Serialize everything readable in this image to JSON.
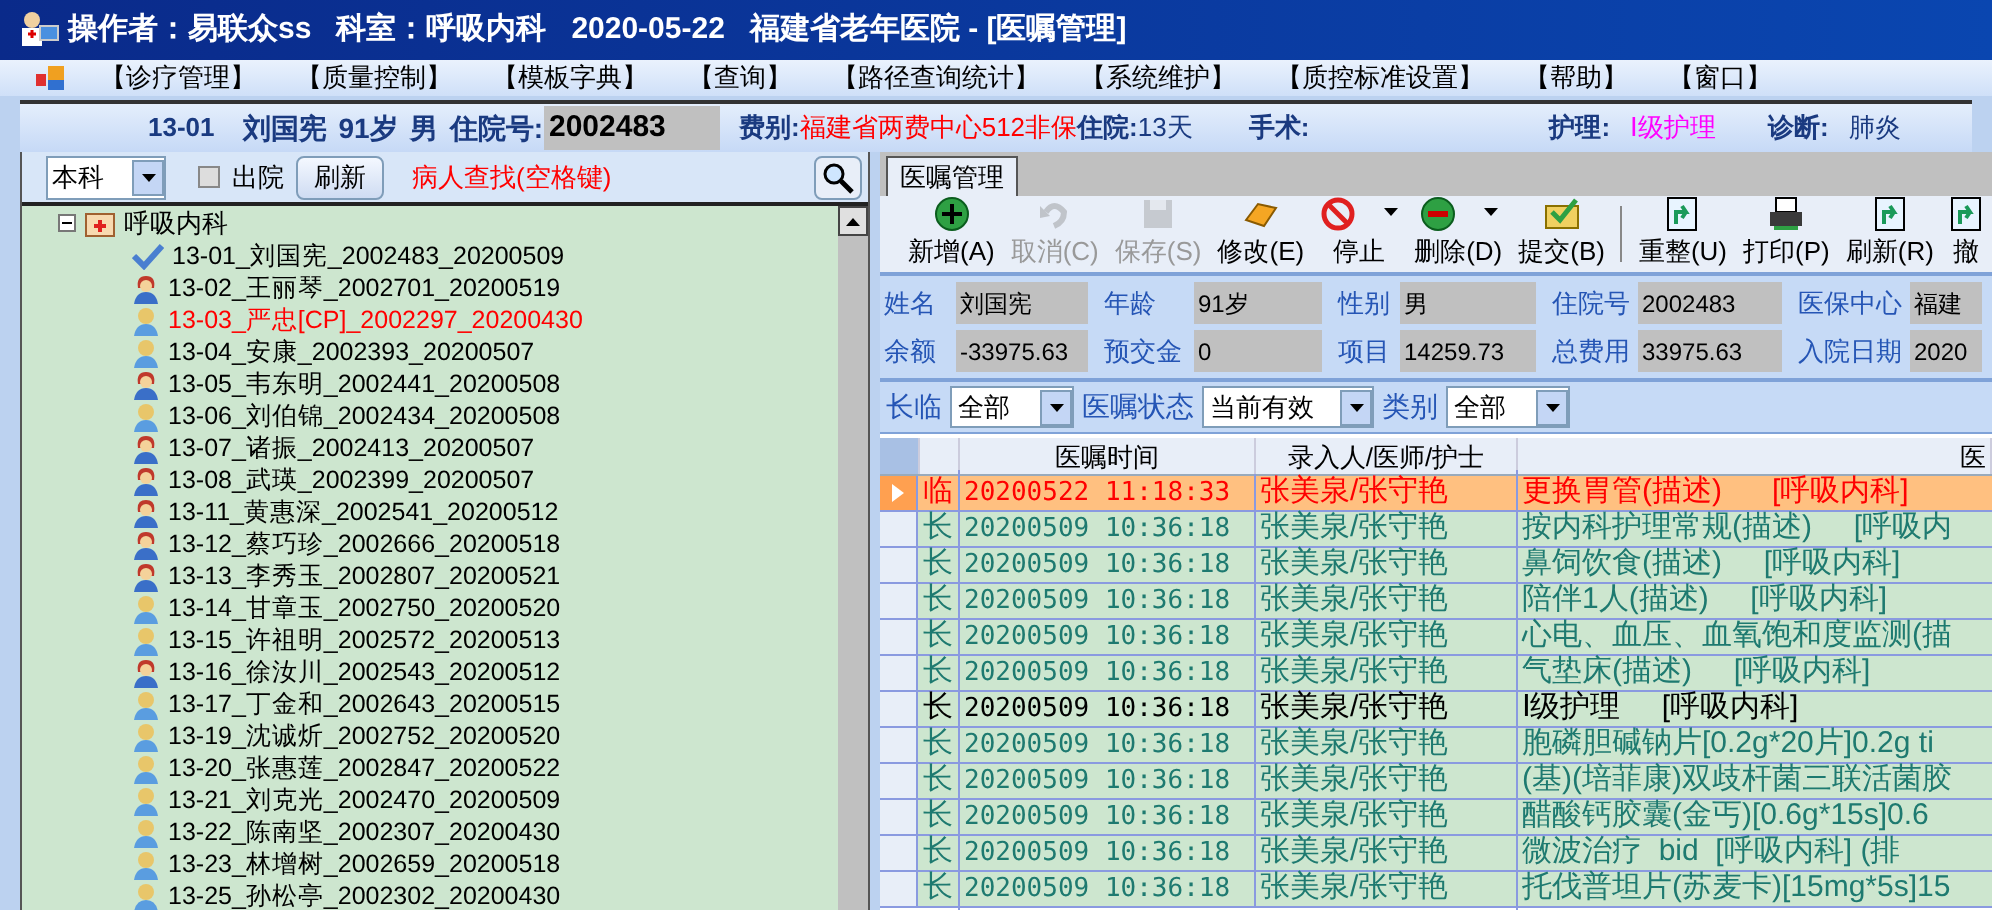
{
  "window": {
    "title": "操作者：易联众ss   科室：呼吸内科   2020-05-22   福建省老年医院 - [医嘱管理]"
  },
  "menu": [
    "【诊疗管理】",
    "【质量控制】",
    "【模板字典】",
    "【查询】",
    "【路径查询统计】",
    "【系统维护】",
    "【质控标准设置】",
    "【帮助】",
    "【窗口】"
  ],
  "patient_header": {
    "bed": "13-01",
    "name": "刘国宪",
    "age": "91岁",
    "sex": "男",
    "admission_label": "住院号:",
    "admission_no": "2002483",
    "fee_label": "费别:",
    "fee_type": "福建省两费中心512非保",
    "stay_label": "住院:",
    "stay": "13天",
    "surgery_label": "手术:",
    "nursing_label": "护理:",
    "nursing": "Ⅰ级护理",
    "diagnosis_label": "诊断:",
    "diagnosis": "肺炎"
  },
  "patient_list": {
    "department_select": "本科",
    "discharged": {
      "label": "出院",
      "checked": false
    },
    "refresh_button": "刷新",
    "search_hint": "病人查找(空格键)",
    "tree": [
      {
        "label": "呼吸内科",
        "expanded": true,
        "children": [
          {
            "label": "13-01_刘国宪_2002483_20200509",
            "kind": "checked",
            "alert": false
          },
          {
            "label": "13-02_王丽琴_2002701_20200519",
            "kind": "female",
            "alert": false
          },
          {
            "label": "13-03_严忠[CP]_2002297_20200430",
            "kind": "male",
            "alert": true
          },
          {
            "label": "13-04_安康_2002393_20200507",
            "kind": "male",
            "alert": false
          },
          {
            "label": "13-05_韦东明_2002441_20200508",
            "kind": "female",
            "alert": false
          },
          {
            "label": "13-06_刘伯锦_2002434_20200508",
            "kind": "male",
            "alert": false
          },
          {
            "label": "13-07_诸振_2002413_20200507",
            "kind": "female",
            "alert": false
          },
          {
            "label": "13-08_武瑛_2002399_20200507",
            "kind": "female",
            "alert": false
          },
          {
            "label": "13-11_黄惠深_2002541_20200512",
            "kind": "female",
            "alert": false
          },
          {
            "label": "13-12_蔡巧珍_2002666_20200518",
            "kind": "female",
            "alert": false
          },
          {
            "label": "13-13_李秀玉_2002807_20200521",
            "kind": "female",
            "alert": false
          },
          {
            "label": "13-14_甘章玉_2002750_20200520",
            "kind": "male",
            "alert": false
          },
          {
            "label": "13-15_许祖明_2002572_20200513",
            "kind": "male",
            "alert": false
          },
          {
            "label": "13-16_徐汝川_2002543_20200512",
            "kind": "female",
            "alert": false
          },
          {
            "label": "13-17_丁金和_2002643_20200515",
            "kind": "male",
            "alert": false
          },
          {
            "label": "13-19_沈诚炘_2002752_20200520",
            "kind": "male",
            "alert": false
          },
          {
            "label": "13-20_张惠莲_2002847_20200522",
            "kind": "male",
            "alert": false
          },
          {
            "label": "13-21_刘克光_2002470_20200509",
            "kind": "male",
            "alert": false
          },
          {
            "label": "13-22_陈南坚_2002307_20200430",
            "kind": "male",
            "alert": false
          },
          {
            "label": "13-23_林增树_2002659_20200518",
            "kind": "male",
            "alert": false
          },
          {
            "label": "13-25_孙松亭_2002302_20200430",
            "kind": "male",
            "alert": false
          }
        ]
      }
    ]
  },
  "tabs": [
    {
      "label": "医嘱管理",
      "selected": true
    }
  ],
  "toolbar": [
    {
      "label": "新增(A)",
      "kind": "add",
      "disabled": false,
      "dropdown": false
    },
    {
      "label": "取消(C)",
      "kind": "undo",
      "disabled": true,
      "dropdown": false
    },
    {
      "label": "保存(S)",
      "kind": "save",
      "disabled": true,
      "dropdown": false
    },
    {
      "label": "修改(E)",
      "kind": "edit",
      "disabled": false,
      "dropdown": false
    },
    {
      "label": "停止",
      "kind": "stop",
      "disabled": false,
      "dropdown": true
    },
    {
      "label": "删除(D)",
      "kind": "delete",
      "disabled": false,
      "dropdown": true
    },
    {
      "label": "提交(B)",
      "kind": "submit",
      "disabled": false,
      "dropdown": false
    },
    {
      "label": "重整(U)",
      "kind": "reorganize",
      "disabled": false,
      "dropdown": false
    },
    {
      "label": "打印(P)",
      "kind": "print",
      "disabled": false,
      "dropdown": false
    },
    {
      "label": "刷新(R)",
      "kind": "reorganize",
      "disabled": false,
      "dropdown": false
    },
    {
      "label": "撤",
      "kind": "reorganize",
      "disabled": false,
      "dropdown": false
    }
  ],
  "patient_info": [
    {
      "label": "姓名",
      "value": "刘国宪"
    },
    {
      "label": "年龄",
      "value": "91岁"
    },
    {
      "label": "性别",
      "value": "男"
    },
    {
      "label": "住院号",
      "value": "2002483"
    },
    {
      "label": "医保中心",
      "value": "福建"
    },
    {
      "label": "余额",
      "value": "-33975.63"
    },
    {
      "label": "预交金",
      "value": "0"
    },
    {
      "label": "项目",
      "value": "14259.73"
    },
    {
      "label": "总费用",
      "value": "33975.63"
    },
    {
      "label": "入院日期",
      "value": "2020"
    }
  ],
  "filters": [
    {
      "label": "长临",
      "value": "全部"
    },
    {
      "label": "医嘱状态",
      "value": "当前有效"
    },
    {
      "label": "类别",
      "value": "全部"
    }
  ],
  "orders_table": {
    "columns": [
      "医嘱时间",
      "录入人/医师/护士",
      "医"
    ],
    "rows": [
      {
        "selected": true,
        "kind": "alert",
        "type": "临",
        "time": "20200522 11:18:33",
        "staff": "张美泉/张守艳",
        "content": "更换胃管(描述)      [呼吸内科]"
      },
      {
        "selected": false,
        "kind": "active",
        "type": "长",
        "time": "20200509 10:36:18",
        "staff": "张美泉/张守艳",
        "content": "按内科护理常规(描述)     [呼吸内"
      },
      {
        "selected": false,
        "kind": "active",
        "type": "长",
        "time": "20200509 10:36:18",
        "staff": "张美泉/张守艳",
        "content": "鼻饲饮食(描述)     [呼吸内科]"
      },
      {
        "selected": false,
        "kind": "active",
        "type": "长",
        "time": "20200509 10:36:18",
        "staff": "张美泉/张守艳",
        "content": "陪伴1人(描述)     [呼吸内科]"
      },
      {
        "selected": false,
        "kind": "active",
        "type": "长",
        "time": "20200509 10:36:18",
        "staff": "张美泉/张守艳",
        "content": "心电、血压、血氧饱和度监测(描"
      },
      {
        "selected": false,
        "kind": "active",
        "type": "长",
        "time": "20200509 10:36:18",
        "staff": "张美泉/张守艳",
        "content": "气垫床(描述)     [呼吸内科]"
      },
      {
        "selected": false,
        "kind": "plain",
        "type": "长",
        "time": "20200509 10:36:18",
        "staff": "张美泉/张守艳",
        "content": "Ⅰ级护理     [呼吸内科]"
      },
      {
        "selected": false,
        "kind": "active",
        "type": "长",
        "time": "20200509 10:36:18",
        "staff": "张美泉/张守艳",
        "content": "胞磷胆碱钠片[0.2g*20片]0.2g ti"
      },
      {
        "selected": false,
        "kind": "active",
        "type": "长",
        "time": "20200509 10:36:18",
        "staff": "张美泉/张守艳",
        "content": "(基)(培菲康)双歧杆菌三联活菌胶"
      },
      {
        "selected": false,
        "kind": "active",
        "type": "长",
        "time": "20200509 10:36:18",
        "staff": "张美泉/张守艳",
        "content": "醋酸钙胶囊(金丐)[0.6g*15s]0.6"
      },
      {
        "selected": false,
        "kind": "active",
        "type": "长",
        "time": "20200509 10:36:18",
        "staff": "张美泉/张守艳",
        "content": "微波治疗  bid  [呼吸内科] (排"
      },
      {
        "selected": false,
        "kind": "active",
        "type": "长",
        "time": "20200509 10:36:18",
        "staff": "张美泉/张守艳",
        "content": "托伐普坦片(苏麦卡)[15mg*5s]15"
      }
    ]
  }
}
